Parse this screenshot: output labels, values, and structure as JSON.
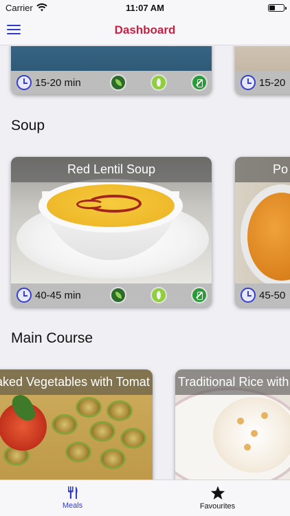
{
  "status_bar": {
    "carrier": "Carrier",
    "time": "11:07 AM"
  },
  "nav": {
    "title": "Dashboard",
    "title_color": "#c91f43",
    "menu_icon": "hamburger-menu-icon"
  },
  "top_row": {
    "cards": [
      {
        "time": "15-20 min",
        "badges": [
          "vegan-icon",
          "gluten-free-icon",
          "lactose-free-icon"
        ]
      },
      {
        "time": "15-20"
      }
    ]
  },
  "sections": [
    {
      "title": "Soup",
      "cards": [
        {
          "title": "Red Lentil Soup",
          "time": "40-45 min",
          "badges": [
            "vegan-icon",
            "gluten-free-icon",
            "lactose-free-icon"
          ]
        },
        {
          "title": "Po",
          "time": "45-50"
        }
      ]
    },
    {
      "title": "Main Course",
      "cards": [
        {
          "title": "aked Vegetables with Tomat"
        },
        {
          "title": "Traditional Rice with"
        }
      ]
    }
  ],
  "tabs": [
    {
      "label": "Meals",
      "icon": "fork-knife-icon",
      "active": true
    },
    {
      "label": "Favourites",
      "icon": "star-icon",
      "active": false
    }
  ],
  "colors": {
    "accent": "#2f3bc7",
    "background": "#efeff4"
  }
}
